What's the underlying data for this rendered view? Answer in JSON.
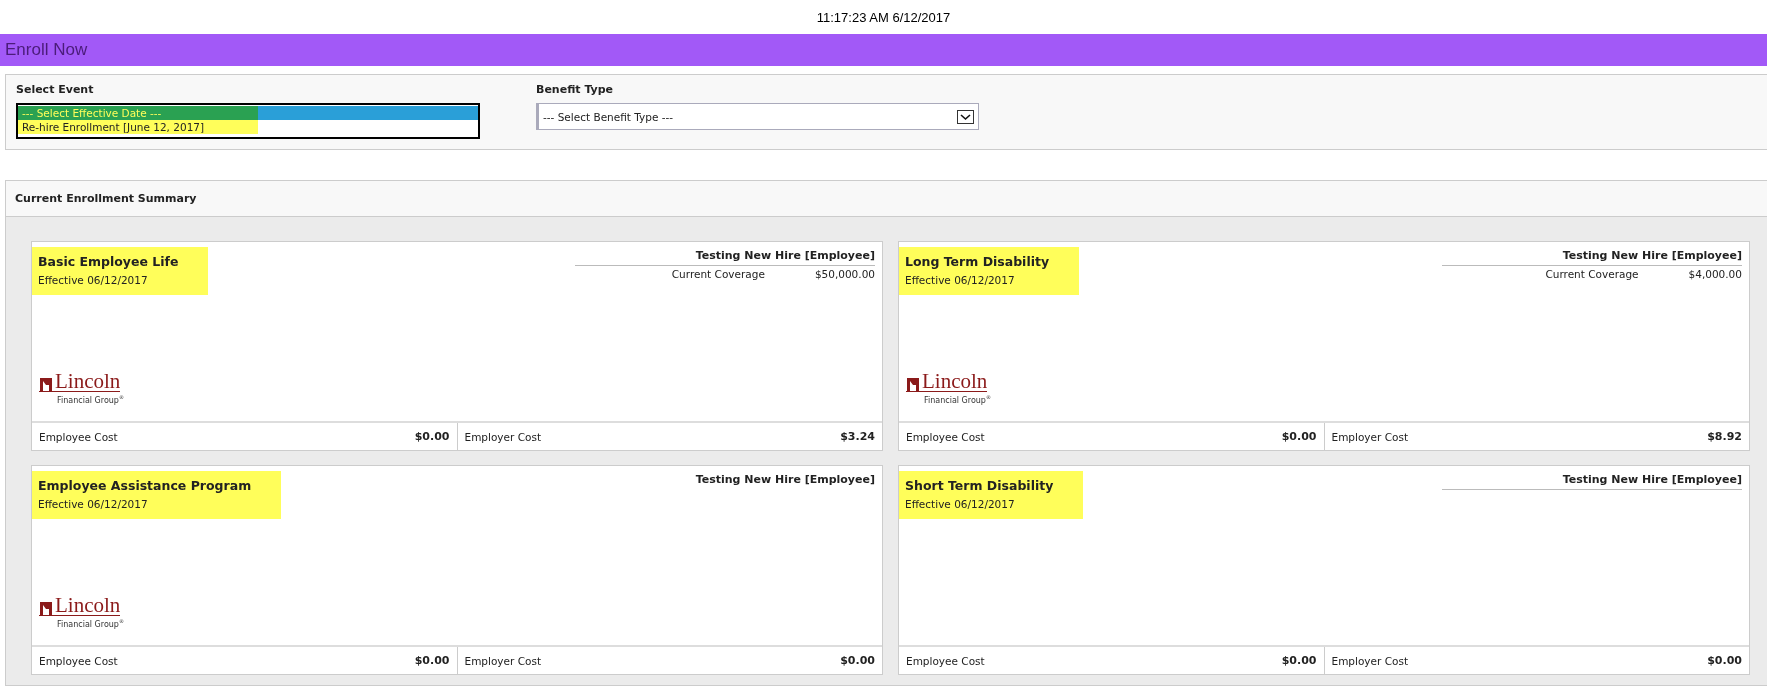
{
  "clock": "11:17:23 AM 6/12/2017",
  "page_title": "Enroll Now",
  "filters": {
    "event": {
      "label": "Select Event",
      "options": [
        {
          "label": "--- Select Effective Date ---",
          "selected": true
        },
        {
          "label": "Re-hire Enrollment [June 12, 2017]",
          "selected": false
        }
      ]
    },
    "benefit_type": {
      "label": "Benefit Type",
      "value": "--- Select Benefit Type ---"
    }
  },
  "summary": {
    "title": "Current Enrollment Summary",
    "cards": [
      {
        "title": "Basic Employee Life",
        "effective": "Effective 06/12/2017",
        "member": "Testing New Hire [Employee]",
        "rule": true,
        "coverage": {
          "label": "Current Coverage",
          "amount": "$50,000.00"
        },
        "logo": {
          "name": "Lincoln",
          "tagline": "Financial Group$^{®}$"
        },
        "employee_cost": {
          "label": "Employee Cost",
          "amount": "$0.00"
        },
        "employer_cost": {
          "label": "Employer Cost",
          "amount": "$3.24"
        }
      },
      {
        "title": "Long Term Disability",
        "effective": "Effective 06/12/2017",
        "member": "Testing New Hire [Employee]",
        "rule": true,
        "coverage": {
          "label": "Current Coverage",
          "amount": "$4,000.00"
        },
        "logo": {
          "name": "Lincoln",
          "tagline": "Financial Group$^{®}$"
        },
        "employee_cost": {
          "label": "Employee Cost",
          "amount": "$0.00"
        },
        "employer_cost": {
          "label": "Employer Cost",
          "amount": "$8.92"
        }
      },
      {
        "title": "Employee Assistance Program",
        "effective": "Effective 06/12/2017",
        "member": "Testing New Hire [Employee]",
        "rule": false,
        "logo": {
          "name": "Lincoln",
          "tagline": "Financial Group$^{®}$"
        },
        "employee_cost": {
          "label": "Employee Cost",
          "amount": "$0.00"
        },
        "employer_cost": {
          "label": "Employer Cost",
          "amount": "$0.00"
        }
      },
      {
        "title": "Short Term Disability",
        "effective": "Effective 06/12/2017",
        "member": "Testing New Hire [Employee]",
        "rule": true,
        "employee_cost": {
          "label": "Employee Cost",
          "amount": "$0.00"
        },
        "employer_cost": {
          "label": "Employer Cost",
          "amount": "$0.00"
        }
      }
    ]
  }
}
